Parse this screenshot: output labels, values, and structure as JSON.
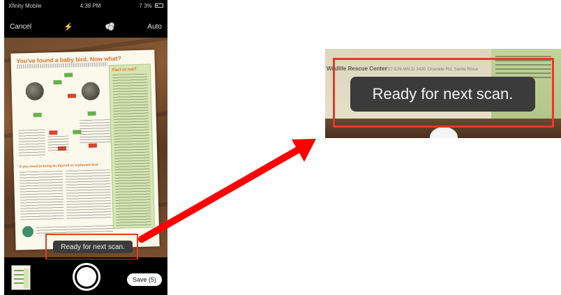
{
  "status_bar": {
    "carrier": "Xfinity Mobile",
    "time": "4:38 PM",
    "battery": "7 3%"
  },
  "camera": {
    "cancel_label": "Cancel",
    "flash_icon": "flash-icon",
    "filter_icon": "filter-icon",
    "auto_label": "Auto"
  },
  "document": {
    "title": "You've found a baby bird. Now what?",
    "side_title": "Fact or not?",
    "orange_note": "If you need to bring an injured or orphaned bird"
  },
  "toast": {
    "message": "Ready for next scan."
  },
  "bottom_bar": {
    "save_label": "Save (5)"
  },
  "zoom": {
    "header": "Wildlife Rescue Center",
    "address": "707-526-WILD   3430 Chanate Rd, Santa Rosa",
    "message": "Ready for next scan."
  },
  "colors": {
    "highlight": "#e03b2b",
    "toast_bg": "#3b3b3b",
    "flash": "#3a8ff0"
  }
}
